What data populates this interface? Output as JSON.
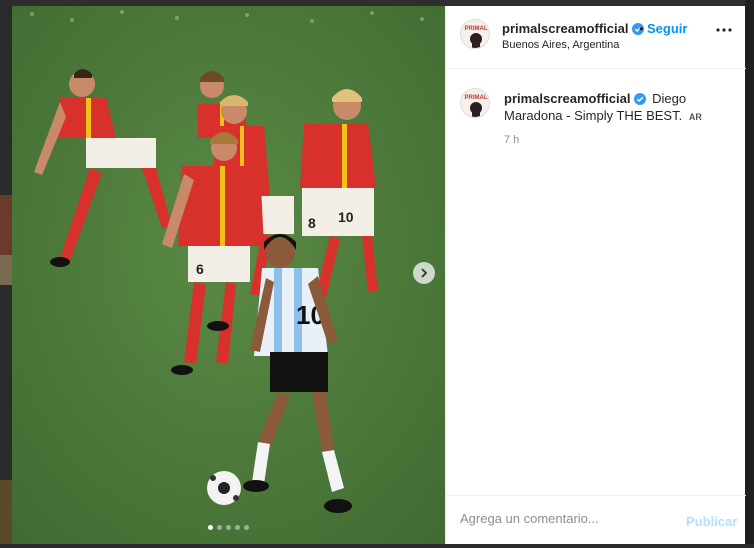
{
  "post": {
    "username": "primalscreamofficial",
    "verified": true,
    "separator": "•",
    "follow_label": "Seguir",
    "location": "Buenos Aires, Argentina",
    "more_icon": "more-horizontal-icon"
  },
  "caption": {
    "username": "primalscreamofficial",
    "text": "Diego Maradona - Simply THE BEST.",
    "translate_badge": "AR",
    "time": "7 h"
  },
  "carousel": {
    "slide_count": 5,
    "active_index": 0,
    "next_icon": "chevron-right-icon"
  },
  "comment": {
    "placeholder": "Agrega un comentario...",
    "publish_label": "Publicar"
  },
  "colors": {
    "link_blue": "#0095f6",
    "publish_disabled": "#b2dffc",
    "verified_blue": "#3897f0",
    "pitch_green": "#4e7a3c"
  }
}
